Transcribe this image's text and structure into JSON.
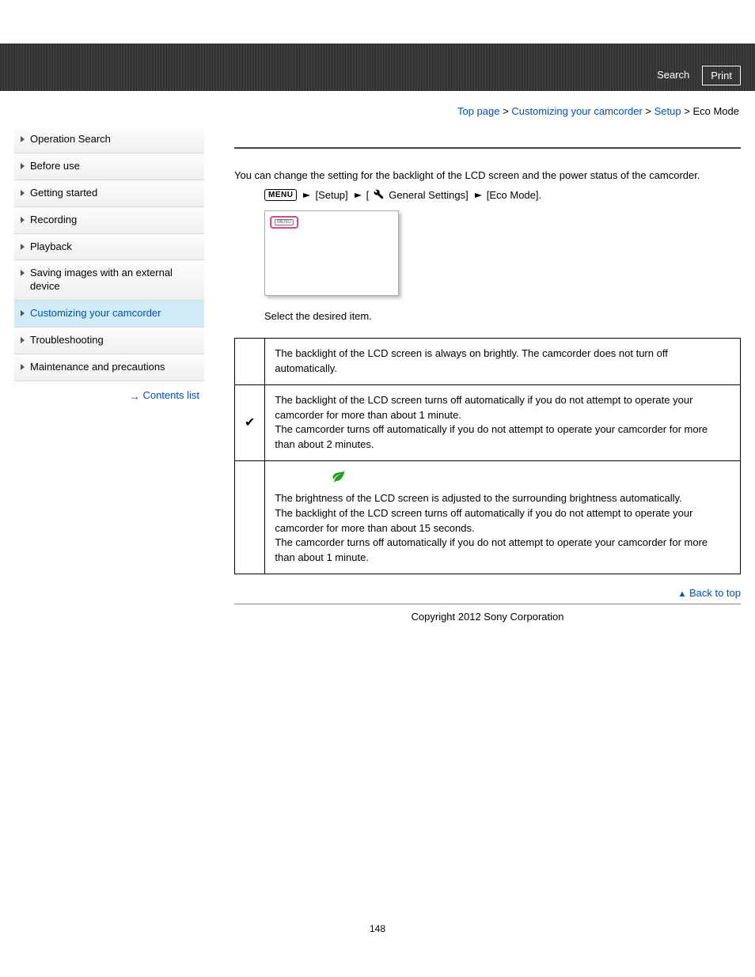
{
  "header": {
    "search": "Search",
    "print": "Print"
  },
  "breadcrumb": {
    "top": "Top page",
    "customizing": "Customizing your camcorder",
    "setup": "Setup",
    "current": "Eco Mode",
    "sep": ">"
  },
  "sidebar": {
    "items": [
      "Operation Search",
      "Before use",
      "Getting started",
      "Recording",
      "Playback",
      "Saving images with an external device",
      "Customizing your camcorder",
      "Troubleshooting",
      "Maintenance and precautions"
    ],
    "active_index": 6,
    "contents_list": "Contents list"
  },
  "main": {
    "intro": "You can change the setting for the backlight of the LCD screen and the power status of the camcorder.",
    "menu_label": "MENU",
    "path_setup": "[Setup]",
    "path_general": "General Settings]",
    "path_eco": "[Eco Mode].",
    "path_bracket": "[",
    "select_text": "Select the desired item.",
    "options": [
      {
        "mark": "",
        "text": "The backlight of the LCD screen is always on brightly. The camcorder does not turn off automatically."
      },
      {
        "mark": "✔",
        "text1": "The backlight of the LCD screen turns off automatically if you do not attempt to operate your camcorder for more than about 1 minute.",
        "text2": "The camcorder turns off automatically if you do not attempt to operate your camcorder for more than about 2 minutes."
      },
      {
        "mark": "",
        "text1": "The brightness of the LCD screen is adjusted to the surrounding brightness automatically.",
        "text2": "The backlight of the LCD screen turns off automatically if you do not attempt to operate your camcorder for more than about 15 seconds.",
        "text3": "The camcorder turns off automatically if you do not attempt to operate your camcorder for more than about 1 minute."
      }
    ]
  },
  "footer": {
    "back_to_top": "Back to top",
    "copyright": "Copyright 2012 Sony Corporation",
    "page_number": "148"
  }
}
